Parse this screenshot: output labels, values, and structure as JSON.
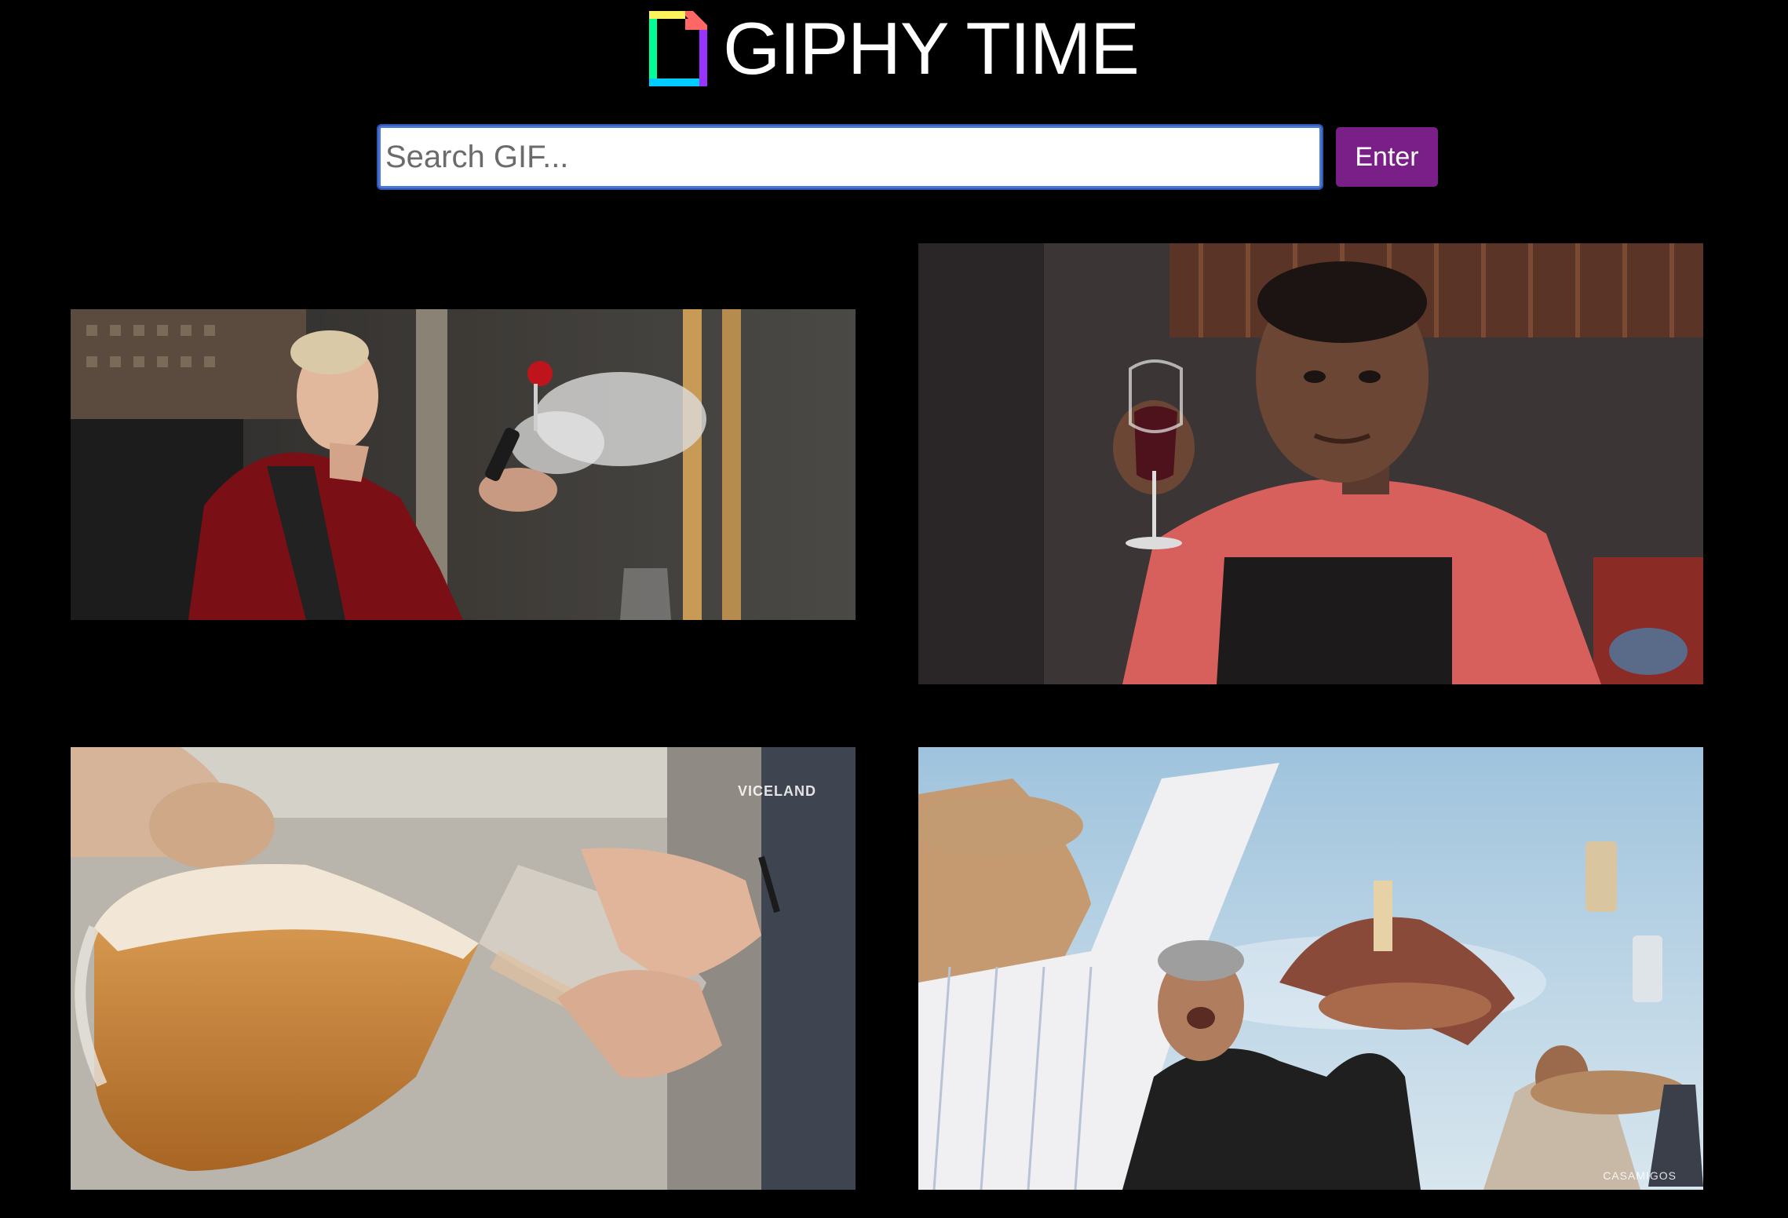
{
  "header": {
    "title": "GIPHY TIME",
    "logo_icon": "giphy-logo-icon"
  },
  "search": {
    "placeholder": "Search GIF...",
    "value": "",
    "button_label": "Enter"
  },
  "colors": {
    "background": "#000000",
    "button": "#7a1f87",
    "input_border": "#4a78d6",
    "title": "#ffffff"
  },
  "results": [
    {
      "name": "gif-man-red-velvet-jacket-phone"
    },
    {
      "name": "gif-man-holding-wine-glass"
    },
    {
      "name": "gif-pouring-beer-pitcher",
      "watermark": "VICELAND"
    },
    {
      "name": "gif-men-toasting-bottles",
      "watermark": "CASAMIGOS"
    }
  ]
}
